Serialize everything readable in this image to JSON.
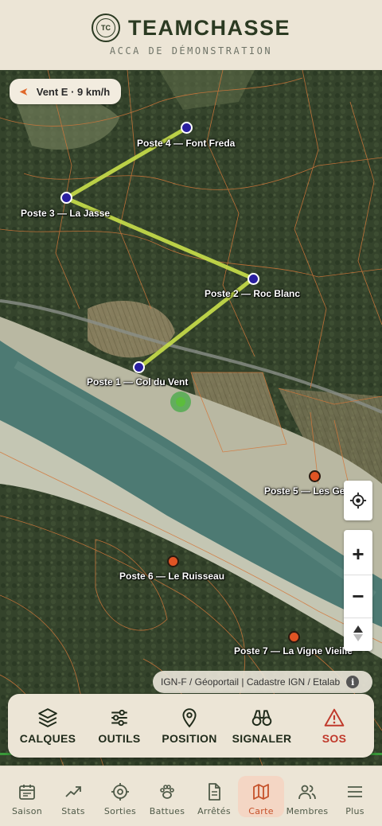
{
  "header": {
    "logo_text": "TC",
    "title": "TEAMCHASSE",
    "subtitle": "ACCA DE DÉMONSTRATION"
  },
  "map": {
    "wind": {
      "label": "Vent E · 9 km/h",
      "icon": "wind-arrow-icon"
    },
    "postes": [
      {
        "label": "Poste 1 — Col du Vent",
        "color": "#2a1fa0"
      },
      {
        "label": "Poste 2 — Roc Blanc",
        "color": "#2a1fa0"
      },
      {
        "label": "Poste 3 — La Jasse",
        "color": "#2a1fa0"
      },
      {
        "label": "Poste 4 — Font Freda",
        "color": "#2a1fa0"
      },
      {
        "label": "Poste 5 — Les Ge",
        "color": "#e05424"
      },
      {
        "label": "Poste 6 — Le Ruisseau",
        "color": "#e05424"
      },
      {
        "label": "Poste 7 — La Vigne Vieille",
        "color": "#e05424"
      }
    ],
    "route_color": "#c9e04a",
    "attribution": "IGN-F / Géoportail | Cadastre IGN / Etalab",
    "controls": {
      "zoom_in": "+",
      "zoom_out": "−"
    }
  },
  "actions": [
    {
      "label": "CALQUES",
      "icon": "layers-icon"
    },
    {
      "label": "OUTILS",
      "icon": "sliders-icon"
    },
    {
      "label": "POSITION",
      "icon": "map-pin-icon"
    },
    {
      "label": "SIGNALER",
      "icon": "binoculars-icon"
    },
    {
      "label": "SOS",
      "icon": "warning-icon",
      "color": "#c0392b"
    }
  ],
  "nav": [
    {
      "label": "Saison",
      "icon": "calendar-icon"
    },
    {
      "label": "Stats",
      "icon": "trend-icon"
    },
    {
      "label": "Sorties",
      "icon": "crosshair-icon"
    },
    {
      "label": "Battues",
      "icon": "paw-icon"
    },
    {
      "label": "Arrêtés",
      "icon": "document-icon"
    },
    {
      "label": "Carte",
      "icon": "map-icon",
      "active": true
    },
    {
      "label": "Membres",
      "icon": "users-icon"
    },
    {
      "label": "Plus",
      "icon": "menu-icon"
    }
  ]
}
